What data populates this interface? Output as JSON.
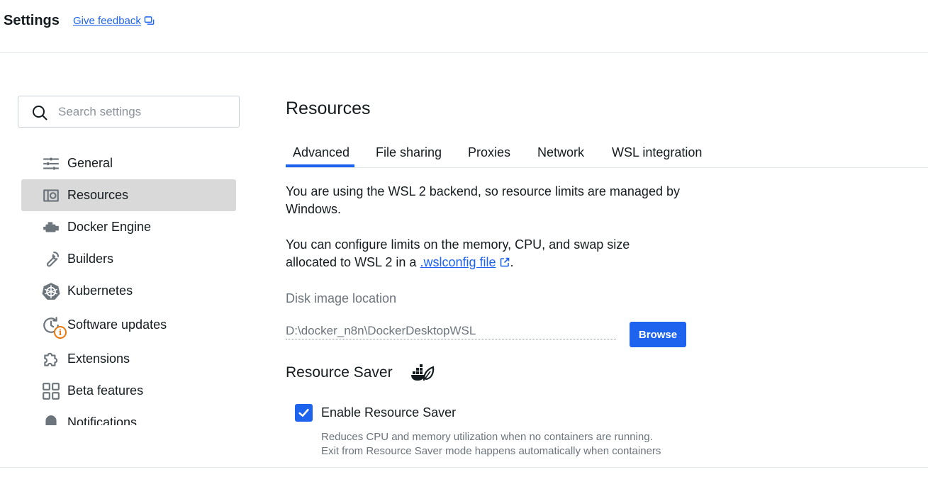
{
  "header": {
    "title": "Settings",
    "feedback_label": "Give feedback"
  },
  "search": {
    "placeholder": "Search settings",
    "value": ""
  },
  "sidebar": {
    "items": [
      {
        "label": "General",
        "icon": "sliders-icon",
        "active": false
      },
      {
        "label": "Resources",
        "icon": "resources-icon",
        "active": true
      },
      {
        "label": "Docker Engine",
        "icon": "engine-icon",
        "active": false
      },
      {
        "label": "Builders",
        "icon": "wrench-icon",
        "active": false
      },
      {
        "label": "Kubernetes",
        "icon": "helm-icon",
        "active": false
      },
      {
        "label": "Software updates",
        "icon": "clock-update-icon",
        "active": false,
        "badge": "i"
      },
      {
        "label": "Extensions",
        "icon": "puzzle-icon",
        "active": false
      },
      {
        "label": "Beta features",
        "icon": "grid-icon",
        "active": false
      },
      {
        "label": "Notifications",
        "icon": "bell-icon",
        "active": false
      }
    ]
  },
  "main": {
    "title": "Resources",
    "tabs": [
      {
        "label": "Advanced",
        "active": true
      },
      {
        "label": "File sharing",
        "active": false
      },
      {
        "label": "Proxies",
        "active": false
      },
      {
        "label": "Network",
        "active": false
      },
      {
        "label": "WSL integration",
        "active": false
      }
    ],
    "wsl_notice_line1": "You are using the WSL 2 backend, so resource limits are managed by",
    "wsl_notice_line2": "Windows.",
    "config_line1": "You can configure limits on the memory, CPU, and swap size",
    "config_line2_prefix": "allocated to WSL 2 in a ",
    "config_link": ".wslconfig file",
    "config_line2_suffix": ".",
    "disk_label": "Disk image location",
    "disk_path": "D:\\docker_n8n\\DockerDesktopWSL",
    "browse_label": "Browse",
    "resource_saver_title": "Resource Saver",
    "enable_resource_saver_label": "Enable Resource Saver",
    "enable_resource_saver_checked": true,
    "help_line1": "Reduces CPU and memory utilization when no containers are running.",
    "help_line2": "Exit from Resource Saver mode happens automatically when containers"
  },
  "colors": {
    "accent": "#1d63ed",
    "active_nav_bg": "#d9d9d9",
    "badge": "#e9780c",
    "icon_gray": "#6c747c"
  }
}
